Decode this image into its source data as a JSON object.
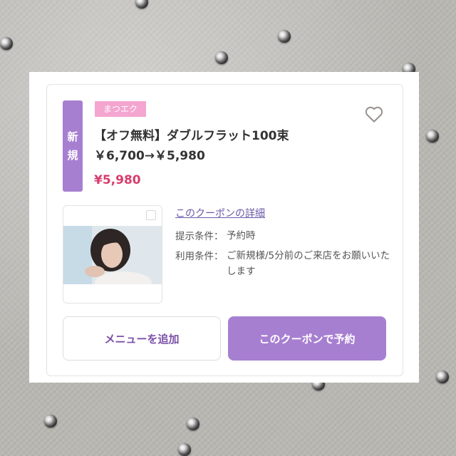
{
  "coupon": {
    "new_badge": [
      "新",
      "規"
    ],
    "category": "まつエク",
    "title_line1": "【オフ無料】ダブルフラット100束",
    "title_line2": "￥6,700→￥5,980",
    "price": "¥5,980",
    "detail_link": "このクーポンの詳細",
    "conditions": [
      {
        "label": "提示条件：",
        "value": "予約時"
      },
      {
        "label": "利用条件：",
        "value": "ご新規様/5分前のご来店をお願いいたします"
      }
    ],
    "add_menu_button": "メニューを追加",
    "reserve_button": "このクーポンで予約",
    "colors": {
      "accent": "#a77fd1",
      "tag": "#f4a6d0",
      "price": "#d63d6e",
      "link": "#6b5aa8"
    },
    "icons": {
      "favorite": "heart-outline-icon"
    }
  }
}
